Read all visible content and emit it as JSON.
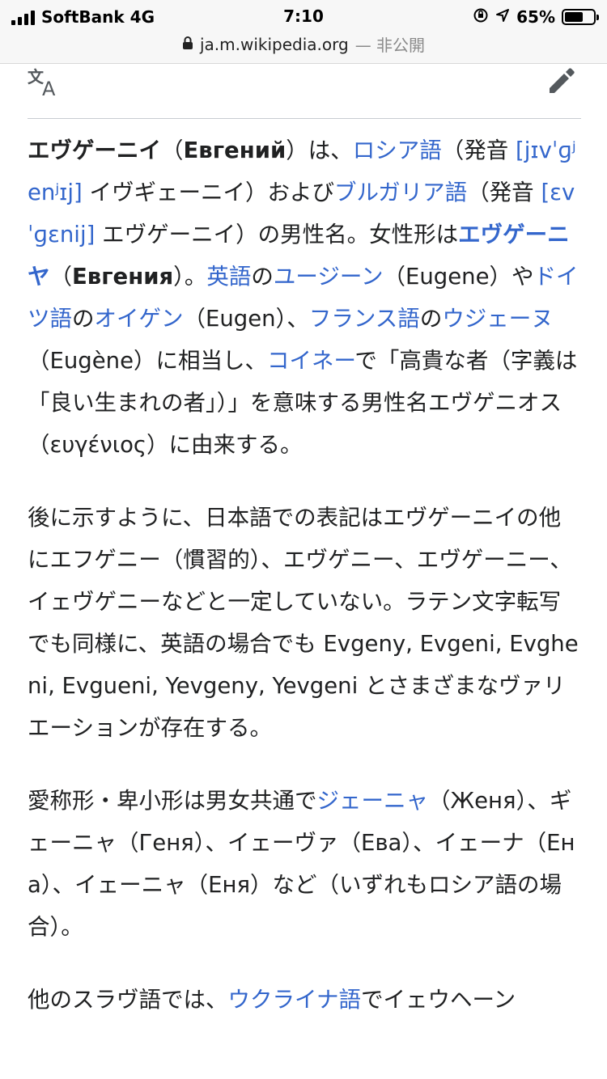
{
  "status_bar": {
    "carrier": "SoftBank 4G",
    "time": "7:10",
    "battery": "65%",
    "battery_level": 0.65
  },
  "url_bar": {
    "domain": "ja.m.wikipedia.org",
    "visibility": "— 非公開"
  },
  "toolbar": {
    "language_icon": "translate-icon",
    "edit_icon": "pencil-icon"
  },
  "colors": {
    "link": "#3366cc",
    "text": "#202122",
    "divider": "#c8ccd1"
  },
  "paragraphs": [
    {
      "runs": [
        {
          "type": "bold",
          "text": "エヴゲーニイ"
        },
        {
          "type": "text",
          "text": "（"
        },
        {
          "type": "bold",
          "text": "Евгений"
        },
        {
          "type": "text",
          "text": "）は、"
        },
        {
          "type": "link",
          "text": "ロシア語"
        },
        {
          "type": "text",
          "text": "（発音 "
        },
        {
          "type": "link",
          "text": "[jɪvˈɡʲenʲɪj]"
        },
        {
          "type": "text",
          "text": " イヴギェーニイ）および"
        },
        {
          "type": "link",
          "text": "ブルガリア語"
        },
        {
          "type": "text",
          "text": "（発音 "
        },
        {
          "type": "link",
          "text": "[ɛvˈɡɛnij]"
        },
        {
          "type": "text",
          "text": " エヴゲーニイ）の男性名。女性形は"
        },
        {
          "type": "boldlink",
          "text": "エヴゲーニヤ"
        },
        {
          "type": "text",
          "text": "（"
        },
        {
          "type": "bold",
          "text": "Евгения"
        },
        {
          "type": "text",
          "text": "）。"
        },
        {
          "type": "link",
          "text": "英語"
        },
        {
          "type": "text",
          "text": "の"
        },
        {
          "type": "link",
          "text": "ユージーン"
        },
        {
          "type": "text",
          "text": "（Eugene）や"
        },
        {
          "type": "link",
          "text": "ドイツ語"
        },
        {
          "type": "text",
          "text": "の"
        },
        {
          "type": "link",
          "text": "オイゲン"
        },
        {
          "type": "text",
          "text": "（Eugen）、"
        },
        {
          "type": "link",
          "text": "フランス語"
        },
        {
          "type": "text",
          "text": "の"
        },
        {
          "type": "link",
          "text": "ウジェーヌ"
        },
        {
          "type": "text",
          "text": "（Eugène）に相当し、"
        },
        {
          "type": "link",
          "text": "コイネー"
        },
        {
          "type": "text",
          "text": "で「高貴な者（字義は「良い生まれの者」）」を意味する男性名エヴゲニオス（ευγένιος）に由来する。"
        }
      ]
    },
    {
      "runs": [
        {
          "type": "text",
          "text": "後に示すように、日本語での表記はエヴゲーニイの他にエフゲニー（慣習的）、エヴゲニー、エヴゲーニー、イェヴゲニーなどと一定していない。ラテン文字転写でも同様に、英語の場合でも Evgeny, Evgeni, Evgheni, Evgueni, Yevgeny, Yevgeni とさまざまなヴァリエーションが存在する。"
        }
      ]
    },
    {
      "runs": [
        {
          "type": "text",
          "text": "愛称形・卑小形は男女共通で"
        },
        {
          "type": "link",
          "text": "ジェーニャ"
        },
        {
          "type": "text",
          "text": "（Женя）、ギェーニャ（Геня）、イェーヴァ（Ева）、イェーナ（Ена）、イェーニャ（Еня）など（いずれもロシア語の場合）。"
        }
      ]
    },
    {
      "runs": [
        {
          "type": "text",
          "text": "他のスラヴ語では、"
        },
        {
          "type": "link",
          "text": "ウクライナ語"
        },
        {
          "type": "text",
          "text": "でイェウヘーン"
        }
      ]
    }
  ]
}
